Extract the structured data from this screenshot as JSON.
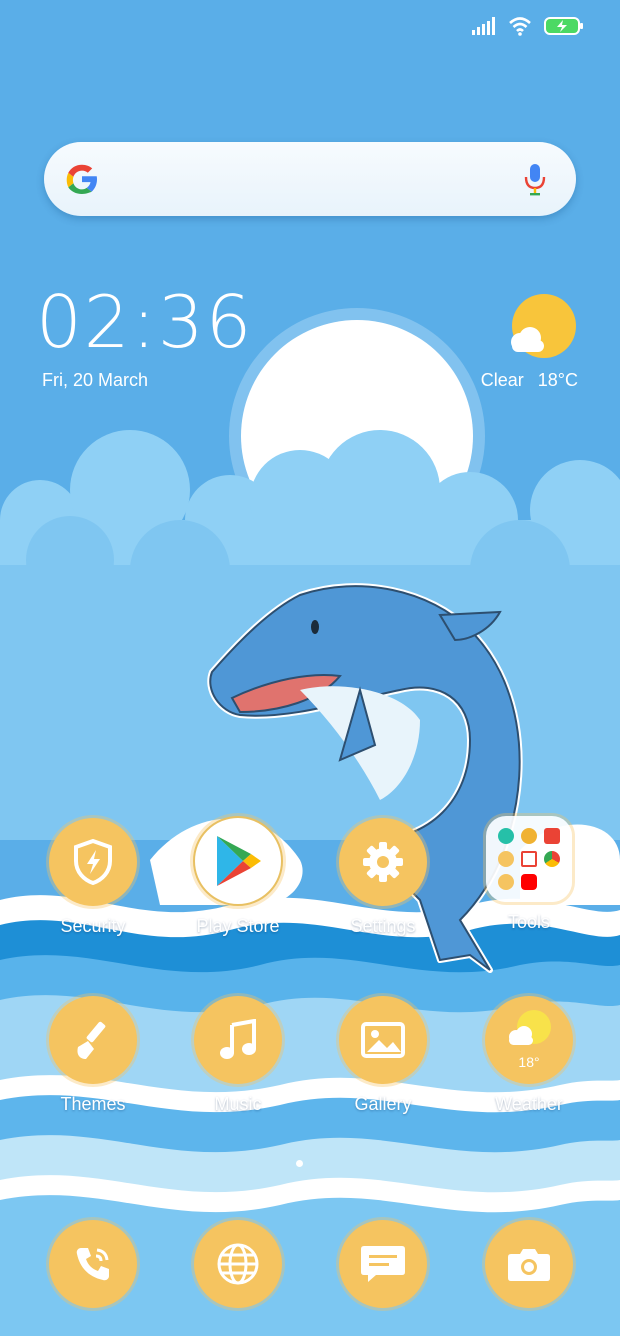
{
  "status_bar": {
    "signal_icon": "signal-icon",
    "wifi_icon": "wifi-icon",
    "battery_icon": "battery-charging-icon"
  },
  "search": {
    "logo_icon": "google-logo-icon",
    "mic_icon": "microphone-icon"
  },
  "clock": {
    "time": "02:36",
    "date": "Fri, 20 March"
  },
  "weather": {
    "condition": "Clear",
    "temperature": "18°C",
    "icon": "sun-cloud-icon"
  },
  "apps_row1": [
    {
      "label": "Security",
      "icon": "shield-bolt-icon"
    },
    {
      "label": "Play Store",
      "icon": "play-store-icon"
    },
    {
      "label": "Settings",
      "icon": "gear-icon"
    },
    {
      "label": "Tools",
      "icon": "folder-icon"
    }
  ],
  "apps_row2": [
    {
      "label": "Themes",
      "icon": "brush-icon"
    },
    {
      "label": "Music",
      "icon": "music-note-icon"
    },
    {
      "label": "Gallery",
      "icon": "image-icon"
    },
    {
      "label": "Weather",
      "icon": "weather-icon",
      "badge": "18°"
    }
  ],
  "dock": [
    {
      "icon": "phone-icon"
    },
    {
      "icon": "globe-icon"
    },
    {
      "icon": "message-icon"
    },
    {
      "icon": "camera-icon"
    }
  ],
  "colors": {
    "sky": "#5aaee8",
    "icon_bg": "#f5c460",
    "wave_dark": "#1e8fd6",
    "wave_light": "#9fd6f5"
  }
}
